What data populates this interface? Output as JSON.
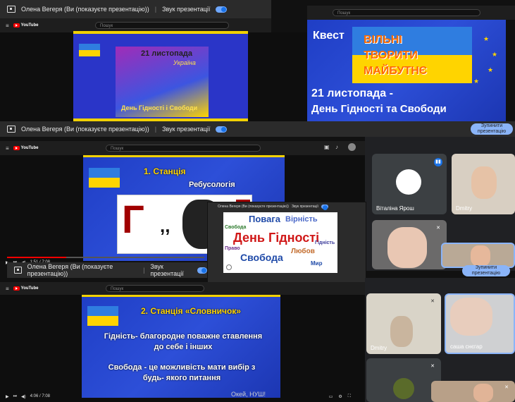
{
  "meet": {
    "presenter_label": "Олена Вегеря (Ви (показуєте презентацію))",
    "sound_label": "Звук презентації",
    "stop_button": "Зупинити презентацію"
  },
  "youtube": {
    "logo": "YouTube",
    "search_placeholder": "Пошук",
    "time1": "1:51 / 7:08",
    "time2": "4:06 / 7:08"
  },
  "slides": {
    "slide1": {
      "date": "21 листопада",
      "country": "Україна",
      "caption": "День Гідності і Свободи"
    },
    "slide2": {
      "quest": "Квест",
      "t1": "ВІЛЬНІ",
      "t2": "ТВОРИТИ",
      "t3": "МАЙБУТНЄ",
      "date": "21 листопада -",
      "caption": "День Гідності та Свободи"
    },
    "slide3": {
      "station": "1. Станція",
      "name": "Ребусологія",
      "comma": ",,",
      "letter": "Г"
    },
    "slide4": {
      "station": "2. Станція «Словничок»",
      "p1": "Гідність- благородне поважне ставлення до себе і інших",
      "p2": "Свобода - це можливість мати вибір з будь- якого питання",
      "tail": "Окей, НУШ!"
    }
  },
  "wordcloud": {
    "main": "День Гідності",
    "w1": "Повага",
    "w2": "Вірність",
    "w3": "Свобода",
    "w4": "Любов",
    "w5": "Гідність",
    "w6": "Свобода",
    "w7": "Право",
    "w8": "Мир"
  },
  "participants": [
    {
      "name": "Віталіна Ярош"
    },
    {
      "name": "Dmitry"
    },
    {
      "name": "Dmitry"
    },
    {
      "name": "саша снєгар"
    }
  ]
}
